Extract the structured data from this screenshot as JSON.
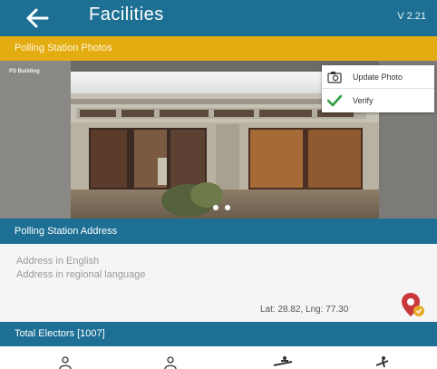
{
  "appbar": {
    "title": "Facilities",
    "version": "V 2.21",
    "back_icon": "back-arrow-icon"
  },
  "photos": {
    "section_title": "Polling Station Photos",
    "photo_label": "PS Building",
    "carousel_dots": 2,
    "menu": [
      {
        "label": "Update Photo",
        "icon": "camera-icon"
      },
      {
        "label": "Verify",
        "icon": "checkmark-icon"
      }
    ]
  },
  "address": {
    "section_title": "Polling Station Address",
    "english_placeholder": "Address in English",
    "regional_placeholder": "Address in regional language",
    "coordinates": "Lat: 28.82, Lng: 77.30",
    "map_icon": "map-pin-icon"
  },
  "electors": {
    "section_title": "Total Electors [1007]"
  },
  "bottom_nav": {
    "icons": [
      "person-icon",
      "person-icon",
      "wheelchair-icon",
      "wheelchair-icon"
    ]
  },
  "colors": {
    "primary": "#1d6f94",
    "accent": "#e3ad12",
    "verify_green": "#2e9b3e",
    "pin_red": "#c8383c"
  }
}
